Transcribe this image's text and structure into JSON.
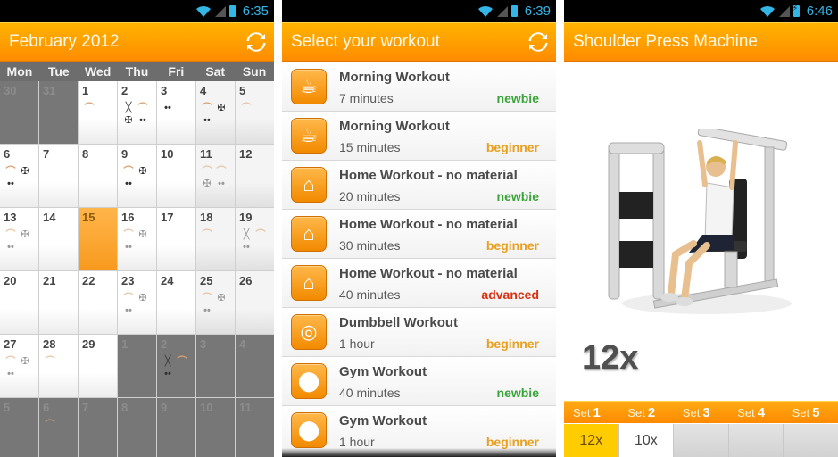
{
  "colors": {
    "accent": "#ff9a00",
    "today": "#f9a63a",
    "newbie": "#3aa43a",
    "beginner": "#e8a020",
    "advanced": "#d83010",
    "status_text": "#33b5e5"
  },
  "screens": [
    {
      "status": {
        "time": "6:35",
        "icons": [
          "wifi-icon",
          "signal-icon",
          "battery-icon"
        ]
      },
      "title": "February 2012",
      "action_icon": "refresh-icon",
      "calendar": {
        "weekdays": [
          "Mon",
          "Tue",
          "Wed",
          "Thu",
          "Fri",
          "Sat",
          "Sun"
        ],
        "today": "15",
        "days": [
          {
            "d": "30",
            "type": "other",
            "icons": []
          },
          {
            "d": "31",
            "type": "other",
            "icons": []
          },
          {
            "d": "1",
            "type": "current",
            "icons": [
              "arm"
            ]
          },
          {
            "d": "2",
            "type": "current",
            "icons": [
              "jump",
              "arm",
              "bike",
              "dumbbell"
            ]
          },
          {
            "d": "3",
            "type": "current",
            "icons": [
              "dumbbell"
            ]
          },
          {
            "d": "4",
            "type": "weekend",
            "icons": [
              "arm",
              "bike",
              "dumbbell"
            ]
          },
          {
            "d": "5",
            "type": "weekend",
            "icons": [
              "arm"
            ],
            "faded": true
          },
          {
            "d": "6",
            "type": "current",
            "icons": [
              "arm",
              "bike",
              "dumbbell"
            ]
          },
          {
            "d": "7",
            "type": "current",
            "icons": []
          },
          {
            "d": "8",
            "type": "current",
            "icons": []
          },
          {
            "d": "9",
            "type": "current",
            "icons": [
              "arm",
              "bike",
              "dumbbell"
            ]
          },
          {
            "d": "10",
            "type": "current",
            "icons": []
          },
          {
            "d": "11",
            "type": "weekend",
            "icons": [
              "arm",
              "arm",
              "bike",
              "dumbbell"
            ],
            "faded": true
          },
          {
            "d": "12",
            "type": "weekend",
            "icons": []
          },
          {
            "d": "13",
            "type": "current",
            "icons": [
              "arm",
              "bike",
              "dumbbell"
            ],
            "faded": true
          },
          {
            "d": "14",
            "type": "current",
            "icons": []
          },
          {
            "d": "15",
            "type": "today",
            "icons": []
          },
          {
            "d": "16",
            "type": "current",
            "icons": [
              "arm",
              "bike",
              "dumbbell"
            ],
            "faded": true
          },
          {
            "d": "17",
            "type": "current",
            "icons": []
          },
          {
            "d": "18",
            "type": "weekend",
            "icons": [
              "arm"
            ],
            "faded": true
          },
          {
            "d": "19",
            "type": "weekend",
            "icons": [
              "jump",
              "arm",
              "dumbbell"
            ],
            "faded": true
          },
          {
            "d": "20",
            "type": "current",
            "icons": []
          },
          {
            "d": "21",
            "type": "current",
            "icons": []
          },
          {
            "d": "22",
            "type": "current",
            "icons": []
          },
          {
            "d": "23",
            "type": "current",
            "icons": [
              "arm",
              "bike",
              "dumbbell"
            ],
            "faded": true
          },
          {
            "d": "24",
            "type": "current",
            "icons": []
          },
          {
            "d": "25",
            "type": "weekend",
            "icons": [
              "arm",
              "bike",
              "dumbbell"
            ],
            "faded": true
          },
          {
            "d": "26",
            "type": "weekend",
            "icons": []
          },
          {
            "d": "27",
            "type": "current",
            "icons": [
              "arm",
              "bike",
              "dumbbell"
            ],
            "faded": true
          },
          {
            "d": "28",
            "type": "current",
            "icons": [
              "arm"
            ],
            "faded": true
          },
          {
            "d": "29",
            "type": "current",
            "icons": []
          },
          {
            "d": "1",
            "type": "other",
            "icons": []
          },
          {
            "d": "2",
            "type": "other",
            "icons": [
              "jump",
              "arm",
              "dumbbell"
            ]
          },
          {
            "d": "3",
            "type": "other",
            "icons": []
          },
          {
            "d": "4",
            "type": "other",
            "icons": []
          },
          {
            "d": "5",
            "type": "other",
            "icons": []
          },
          {
            "d": "6",
            "type": "other",
            "icons": [
              "arm"
            ]
          },
          {
            "d": "7",
            "type": "other",
            "icons": []
          },
          {
            "d": "8",
            "type": "other",
            "icons": []
          },
          {
            "d": "9",
            "type": "other",
            "icons": []
          },
          {
            "d": "10",
            "type": "other",
            "icons": []
          },
          {
            "d": "11",
            "type": "other",
            "icons": []
          }
        ]
      }
    },
    {
      "status": {
        "time": "6:39",
        "icons": [
          "wifi-icon",
          "signal-icon",
          "battery-icon"
        ]
      },
      "title": "Select your workout",
      "action_icon": "refresh-icon",
      "workouts": [
        {
          "title": "Morning Workout",
          "duration": "7 minutes",
          "level": "newbie",
          "icon": "coffee-cup-icon"
        },
        {
          "title": "Morning Workout",
          "duration": "15 minutes",
          "level": "beginner",
          "icon": "coffee-cup-icon"
        },
        {
          "title": "Home Workout - no material",
          "duration": "20 minutes",
          "level": "newbie",
          "icon": "house-icon"
        },
        {
          "title": "Home Workout - no material",
          "duration": "30 minutes",
          "level": "beginner",
          "icon": "house-icon"
        },
        {
          "title": "Home Workout - no material",
          "duration": "40 minutes",
          "level": "advanced",
          "icon": "house-icon"
        },
        {
          "title": "Dumbbell Workout",
          "duration": "1 hour",
          "level": "beginner",
          "icon": "dumbbell-icon"
        },
        {
          "title": "Gym Workout",
          "duration": "40 minutes",
          "level": "newbie",
          "icon": "barbell-icon"
        },
        {
          "title": "Gym Workout",
          "duration": "1 hour",
          "level": "beginner",
          "icon": "barbell-icon"
        }
      ]
    },
    {
      "status": {
        "time": "6:46",
        "icons": [
          "wifi-icon",
          "signal-icon",
          "battery-charging-icon"
        ]
      },
      "title": "Shoulder Press Machine",
      "image": "shoulder-press-machine-illustration",
      "current_reps": "12x",
      "set_word": "Set",
      "sets": [
        {
          "number": "1",
          "reps": "12x",
          "state": "active"
        },
        {
          "number": "2",
          "reps": "10x",
          "state": "done"
        },
        {
          "number": "3",
          "reps": "",
          "state": "pending"
        },
        {
          "number": "4",
          "reps": "",
          "state": "pending"
        },
        {
          "number": "5",
          "reps": "",
          "state": "pending"
        }
      ]
    }
  ]
}
